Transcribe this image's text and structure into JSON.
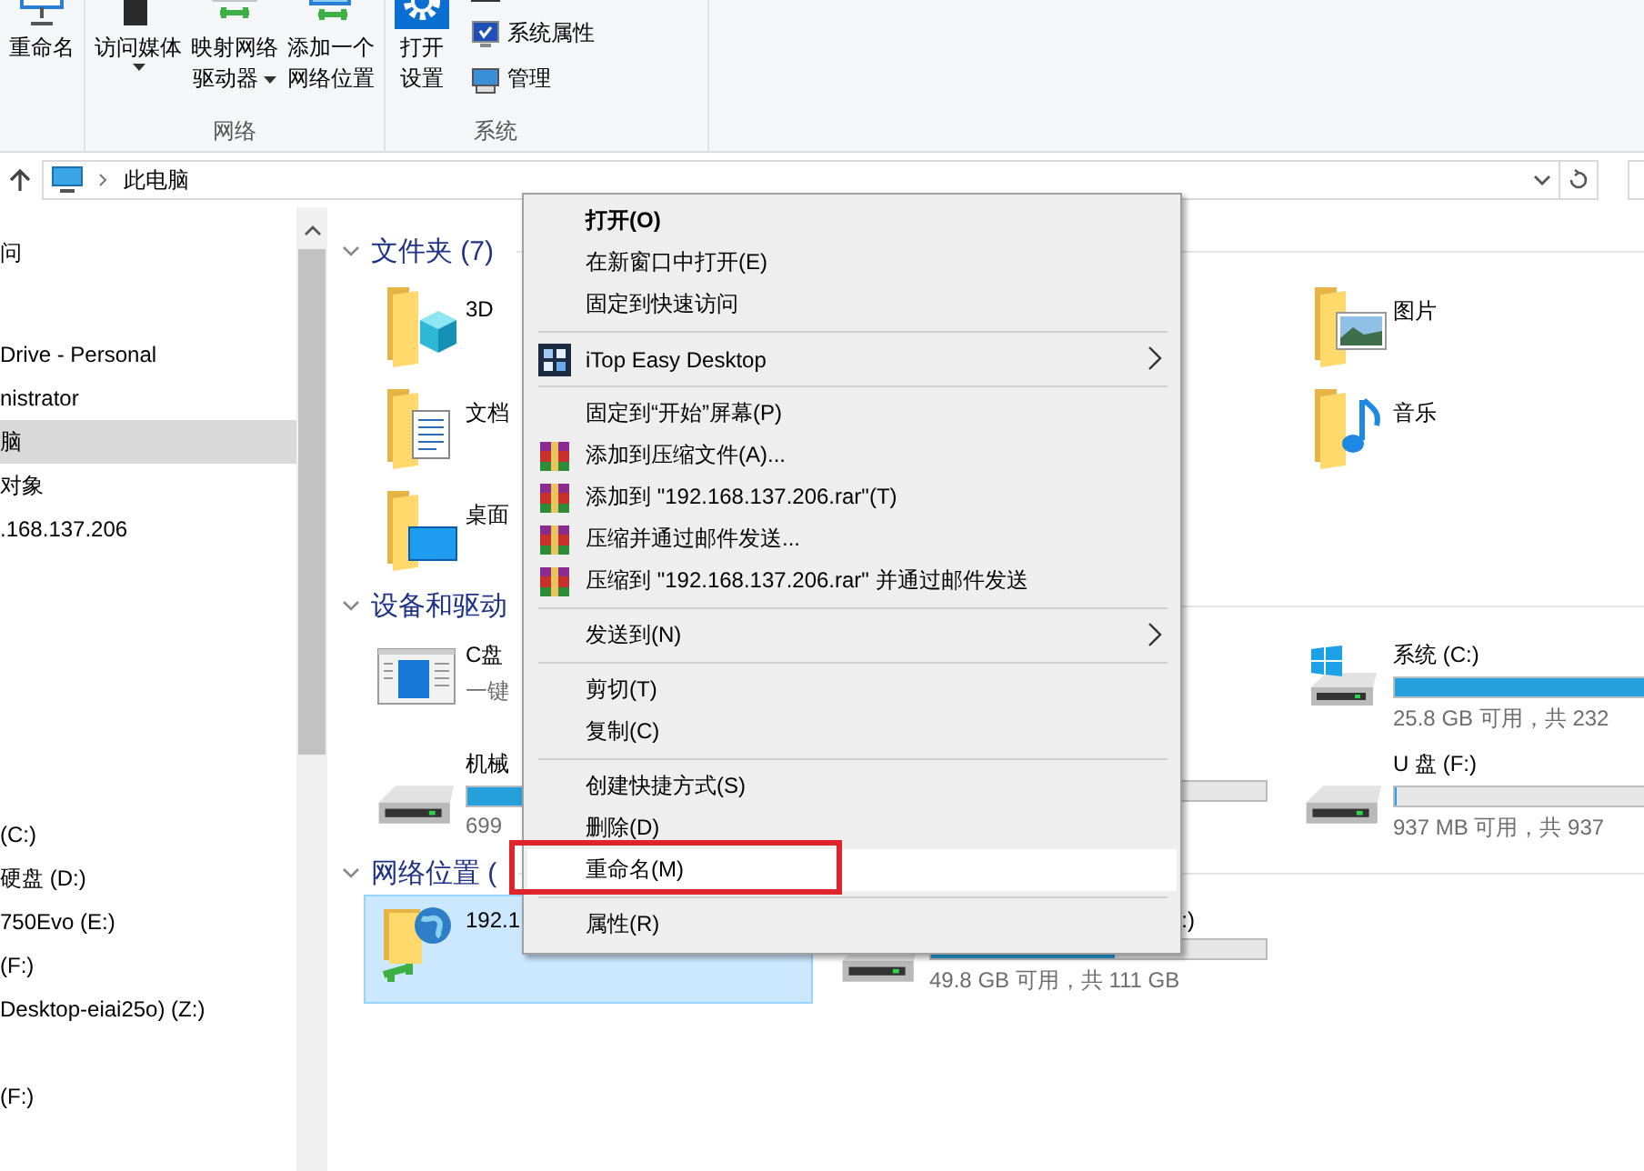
{
  "ribbon": {
    "groups": [
      {
        "buttons": [
          {
            "label_lines": [
              "重命名"
            ],
            "dropdown": false
          }
        ]
      },
      {
        "label": "网络",
        "buttons": [
          {
            "label_lines": [
              "访问媒体"
            ],
            "dropdown": true
          },
          {
            "label_lines": [
              "映射网络",
              "驱动器"
            ],
            "dropdown": true
          },
          {
            "label_lines": [
              "添加一个",
              "网络位置"
            ],
            "dropdown": false
          }
        ]
      },
      {
        "label": "系统",
        "buttons": [
          {
            "label_lines": [
              "打开",
              "设置"
            ],
            "dropdown": false
          }
        ],
        "small_items": [
          {
            "label": "系统属性"
          },
          {
            "label": "管理"
          }
        ]
      }
    ]
  },
  "address_bar": {
    "path": "此电脑"
  },
  "nav": {
    "items": [
      {
        "text": "问",
        "selected": false
      },
      {
        "text": "Drive - Personal",
        "selected": false
      },
      {
        "text": "nistrator",
        "selected": false
      },
      {
        "text": "脑",
        "selected": true
      },
      {
        "text": "对象",
        "selected": false
      },
      {
        "text": ".168.137.206",
        "selected": false
      },
      {
        "selected": false
      },
      {
        "selected": false
      },
      {
        "selected": false
      },
      {
        "selected": false
      },
      {
        "selected": false
      },
      {
        "selected": false
      },
      {
        "text": "(C:)",
        "selected": false
      },
      {
        "text": "硬盘 (D:)",
        "selected": false
      },
      {
        "text": "750Evo (E:)",
        "selected": false
      },
      {
        "text": "(F:)",
        "selected": false
      },
      {
        "text": "Desktop-eiai25o) (Z:)",
        "selected": false
      },
      {
        "selected": false
      },
      {
        "text": "(F:)",
        "selected": false
      }
    ]
  },
  "sections": [
    {
      "title": "文件夹 (7)",
      "expanded": true,
      "rows": [
        [
          {
            "kind": "folder",
            "name": "3D",
            "selected": false
          },
          null,
          {
            "kind": "folder",
            "name": "图片",
            "selected": false
          }
        ],
        [
          {
            "kind": "folder",
            "name": "文档",
            "selected": false
          },
          null,
          {
            "kind": "folder",
            "name": "音乐",
            "selected": false
          }
        ],
        [
          {
            "kind": "folder",
            "name": "桌面",
            "selected": false
          },
          null,
          null
        ]
      ]
    },
    {
      "title": "设备和驱动",
      "expanded": true,
      "rows": [
        [
          {
            "kind": "app",
            "name": "C盘",
            "subtitle": "一键",
            "selected": false
          },
          null,
          {
            "kind": "system",
            "name": "系统 (C:)",
            "level": 0.89,
            "free": "25.8 GB 可用，共 232",
            "selected": false
          }
        ],
        [
          {
            "kind": "drive",
            "name": "机械",
            "level": 0.5,
            "free": "699",
            "selected": false
          },
          {
            "kind": "bare",
            "selected": false
          },
          {
            "kind": "drive",
            "name": "U 盘 (F:)",
            "level": 0,
            "free": "937 MB 可用，共 937",
            "selected": false
          }
        ]
      ]
    },
    {
      "title": "网络位置 (",
      "expanded": true,
      "rows": [
        [
          {
            "kind": "network",
            "name": "192.1",
            "selected": true
          },
          {
            "kind": "drive",
            "name": ":)",
            "level": 0.55,
            "free": "49.8 GB 可用，共 111 GB",
            "selected": false
          },
          null
        ]
      ]
    }
  ],
  "menu": {
    "items": [
      {
        "kind": "item",
        "label": "打开(O)",
        "default": true,
        "submenu": false,
        "selected": false,
        "annotated": false
      },
      {
        "kind": "item",
        "label": "在新窗口中打开(E)",
        "default": false,
        "submenu": false,
        "selected": false,
        "annotated": false
      },
      {
        "kind": "item",
        "label": "固定到快速访问",
        "default": false,
        "submenu": false,
        "selected": false,
        "annotated": false
      },
      {
        "kind": "separator"
      },
      {
        "kind": "app",
        "label": "iTop Easy Desktop",
        "default": false,
        "submenu": true,
        "selected": false,
        "annotated": false
      },
      {
        "kind": "separator"
      },
      {
        "kind": "item",
        "label": "固定到“开始”屏幕(P)",
        "default": false,
        "submenu": false,
        "selected": false,
        "annotated": false
      },
      {
        "kind": "archive",
        "label": "添加到压缩文件(A)...",
        "default": false,
        "submenu": false,
        "selected": false,
        "annotated": false
      },
      {
        "kind": "archive",
        "label": "添加到 \"192.168.137.206.rar\"(T)",
        "default": false,
        "submenu": false,
        "selected": false,
        "annotated": false
      },
      {
        "kind": "archive",
        "label": "压缩并通过邮件发送...",
        "default": false,
        "submenu": false,
        "selected": false,
        "annotated": false
      },
      {
        "kind": "archive",
        "label": "压缩到 \"192.168.137.206.rar\" 并通过邮件发送",
        "default": false,
        "submenu": false,
        "selected": false,
        "annotated": false
      },
      {
        "kind": "separator"
      },
      {
        "kind": "item",
        "label": "发送到(N)",
        "default": false,
        "submenu": true,
        "selected": false,
        "annotated": false
      },
      {
        "kind": "separator"
      },
      {
        "kind": "item",
        "label": "剪切(T)",
        "default": false,
        "submenu": false,
        "selected": false,
        "annotated": false
      },
      {
        "kind": "item",
        "label": "复制(C)",
        "default": false,
        "submenu": false,
        "selected": false,
        "annotated": false
      },
      {
        "kind": "separator"
      },
      {
        "kind": "item",
        "label": "创建快捷方式(S)",
        "default": false,
        "submenu": false,
        "selected": false,
        "annotated": false
      },
      {
        "kind": "item",
        "label": "删除(D)",
        "default": false,
        "submenu": false,
        "selected": false,
        "annotated": false
      },
      {
        "kind": "item",
        "label": "重命名(M)",
        "default": false,
        "submenu": false,
        "selected": true,
        "annotated": true
      },
      {
        "kind": "separator"
      },
      {
        "kind": "item",
        "label": "属性(R)",
        "default": false,
        "submenu": false,
        "selected": false,
        "annotated": false
      }
    ]
  }
}
